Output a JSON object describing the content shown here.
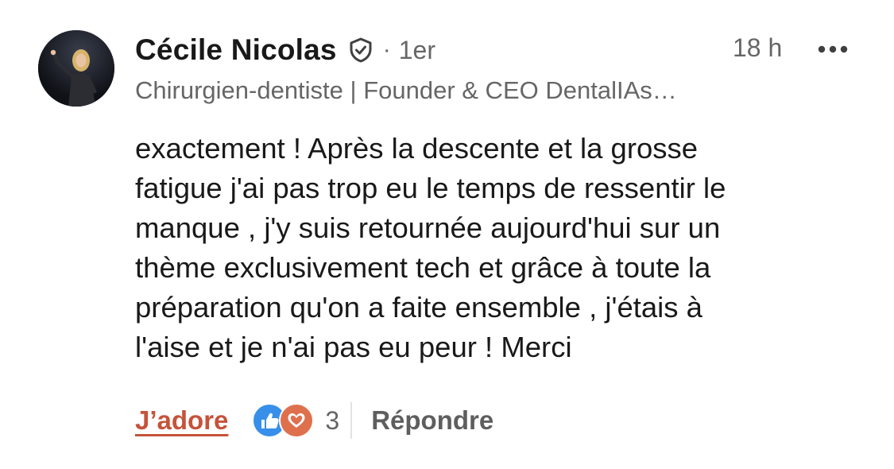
{
  "comment": {
    "author": {
      "name": "Cécile Nicolas",
      "badge_icon": "verified-shield-icon",
      "separator": "·",
      "connection_degree": "1er",
      "headline": "Chirurgien-dentiste | Founder & CEO DentalIAs…"
    },
    "timestamp": "18 h",
    "more_icon": "more-options-icon",
    "text_lines": [
      "exactement ! Après la descente et la grosse",
      "fatigue j'ai pas trop eu le temps de ressentir le",
      "manque , j'y suis retournée aujourd'hui sur un",
      "thème exclusivement tech et grâce à toute la",
      "préparation qu'on a faite ensemble , j'étais à",
      "l'aise et je n'ai pas eu peur ! Merci"
    ],
    "actions": {
      "reaction_label": "J’adore",
      "reaction_icons": [
        "like-icon",
        "love-icon"
      ],
      "reaction_count": "3",
      "reply_label": "Répondre"
    },
    "colors": {
      "reaction_active": "#c5533a",
      "like_blue": "#378fe9",
      "love_red": "#df704d",
      "secondary_text": "#666666"
    }
  }
}
